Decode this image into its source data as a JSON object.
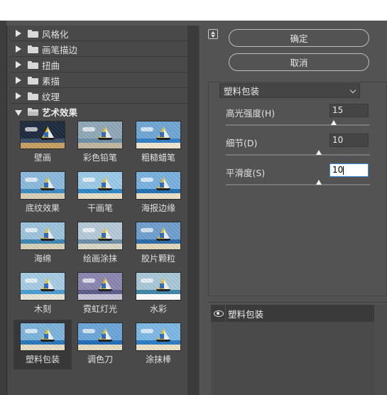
{
  "categories": [
    {
      "label": "风格化",
      "expanded": false
    },
    {
      "label": "画笔描边",
      "expanded": false
    },
    {
      "label": "扭曲",
      "expanded": false
    },
    {
      "label": "素描",
      "expanded": false
    },
    {
      "label": "纹理",
      "expanded": false
    },
    {
      "label": "艺术效果",
      "expanded": true
    }
  ],
  "filters": [
    {
      "label": "壁画",
      "icon": "fresco-thumbnail"
    },
    {
      "label": "彩色铅笔",
      "icon": "colored-pencil-thumbnail"
    },
    {
      "label": "粗糙蜡笔",
      "icon": "rough-pastels-thumbnail"
    },
    {
      "label": "底纹效果",
      "icon": "underpainting-thumbnail"
    },
    {
      "label": "干画笔",
      "icon": "dry-brush-thumbnail"
    },
    {
      "label": "海报边缘",
      "icon": "poster-edges-thumbnail"
    },
    {
      "label": "海绵",
      "icon": "sponge-thumbnail"
    },
    {
      "label": "绘画涂抹",
      "icon": "paint-daubs-thumbnail"
    },
    {
      "label": "胶片颗粒",
      "icon": "film-grain-thumbnail"
    },
    {
      "label": "木刻",
      "icon": "cutout-thumbnail"
    },
    {
      "label": "霓虹灯光",
      "icon": "neon-glow-thumbnail"
    },
    {
      "label": "水彩",
      "icon": "watercolor-thumbnail"
    },
    {
      "label": "塑料包装",
      "icon": "plastic-wrap-thumbnail",
      "selected": true
    },
    {
      "label": "调色刀",
      "icon": "palette-knife-thumbnail"
    },
    {
      "label": "涂抹棒",
      "icon": "smudge-stick-thumbnail"
    }
  ],
  "buttons": {
    "ok": "确定",
    "cancel": "取消"
  },
  "settings": {
    "filter_name": "塑料包装",
    "params": [
      {
        "label": "高光强度(H)",
        "value": "15",
        "slider_fraction": 0.75
      },
      {
        "label": "细节(D)",
        "value": "10",
        "slider_fraction": 0.647
      },
      {
        "label": "平滑度(S)",
        "value": "10",
        "slider_fraction": 0.647,
        "active": true
      }
    ]
  },
  "layers": {
    "items": [
      {
        "label": "塑料包装",
        "visible": true
      }
    ]
  },
  "colors": {
    "panel_bg": "#535353",
    "gallery_bg": "#494949",
    "selected_cell": "#383838",
    "active_input_border": "#3b8de0"
  }
}
